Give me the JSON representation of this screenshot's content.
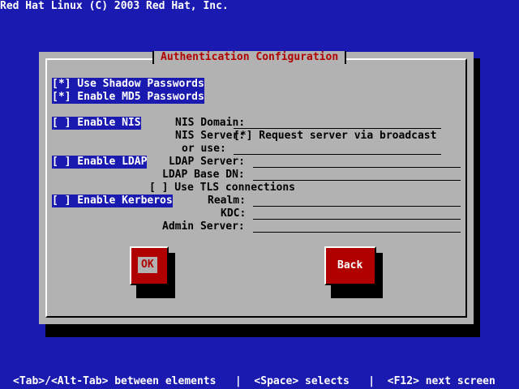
{
  "header": {
    "title": "Red Hat Linux (C) 2003 Red Hat, Inc."
  },
  "dialog": {
    "title": "Authentication Configuration",
    "use_shadow": "[*] Use Shadow Passwords",
    "enable_md5": "[*] Enable MD5 Passwords",
    "enable_nis": "[ ] Enable NIS",
    "nis_domain_label": "NIS Domain:",
    "nis_domain_value": "",
    "nis_server_label": "NIS Server:",
    "nis_broadcast": "[*] Request server via broadcast",
    "or_use_label": "or use:",
    "or_use_value": "",
    "enable_ldap": "[ ] Enable LDAP",
    "ldap_server_label": "LDAP Server:",
    "ldap_server_value": "",
    "ldap_basedn_label": "LDAP Base DN:",
    "ldap_basedn_value": "",
    "use_tls": "[ ] Use TLS connections",
    "enable_kerberos": "[ ] Enable Kerberos",
    "realm_label": "Realm:",
    "realm_value": "",
    "kdc_label": "KDC:",
    "kdc_value": "",
    "admin_server_label": "Admin Server:",
    "admin_server_value": "",
    "ok_label": "OK",
    "back_label": "Back"
  },
  "statusbar": {
    "text": "<Tab>/<Alt-Tab> between elements   |  <Space> selects   |  <F12> next screen"
  },
  "colors": {
    "background": "#1a1ab0",
    "dialog": "#b2b2b2",
    "accent": "#b00000"
  }
}
